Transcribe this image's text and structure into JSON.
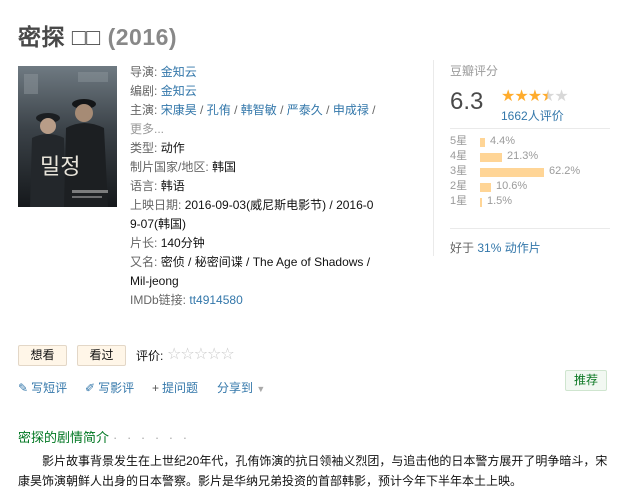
{
  "title": {
    "main": "密探 □□",
    "year": "(2016)"
  },
  "info": {
    "director_label": "导演",
    "director": "金知云",
    "writer_label": "编剧",
    "writer": "金知云",
    "cast_label": "主演",
    "cast": [
      "宋康昊",
      "孔侑",
      "韩智敏",
      "严泰久",
      "申成禄"
    ],
    "more": "更多...",
    "genre_label": "类型:",
    "genre": "动作",
    "country_label": "制片国家/地区:",
    "country": "韩国",
    "language_label": "语言:",
    "language": "韩语",
    "release_label": "上映日期:",
    "release_1": "2016-09-03(威尼斯电影节) / 2016-0",
    "release_2": "9-07(韩国)",
    "runtime_label": "片长:",
    "runtime": "140分钟",
    "aka_label": "又名:",
    "aka_1": "密侦 / 秘密间谍 / The Age of Shadows /",
    "aka_2": "Mil-jeong",
    "imdb_label": "IMDb链接:",
    "imdb": "tt4914580"
  },
  "rating": {
    "label": "豆瓣评分",
    "score": "6.3",
    "stars_filled": 3.5,
    "votes": "1662人评价",
    "distribution": [
      {
        "label": "5星",
        "pct": "4.4%",
        "value": 4.4
      },
      {
        "label": "4星",
        "pct": "21.3%",
        "value": 21.3
      },
      {
        "label": "3星",
        "pct": "62.2%",
        "value": 62.2
      },
      {
        "label": "2星",
        "pct": "10.6%",
        "value": 10.6
      },
      {
        "label": "1星",
        "pct": "1.5%",
        "value": 1.5
      }
    ],
    "better_prefix": "好于",
    "better_link": "31% 动作片"
  },
  "actions": {
    "want": "想看",
    "seen": "看过",
    "rate_label": "评价:",
    "rate_stars": "☆☆☆☆☆"
  },
  "tools": {
    "short_review": "写短评",
    "review": "写影评",
    "question": "提问题",
    "share": "分享到",
    "recommend": "推荐"
  },
  "synopsis": {
    "title": "密探的剧情简介",
    "dots": "· · · · · ·",
    "text": "影片故事背景发生在上世纪20年代，孔侑饰演的抗日领袖义烈团，与追击他的日本警方展开了明争暗斗，宋康昊饰演朝鲜人出身的日本警察。影片是华纳兄弟投资的首部韩影，预计今年下半年本土上映。"
  },
  "colors": {
    "link": "#3377aa",
    "star": "#ffac2d",
    "bar": "#ffd596",
    "section_green": "#007722"
  }
}
